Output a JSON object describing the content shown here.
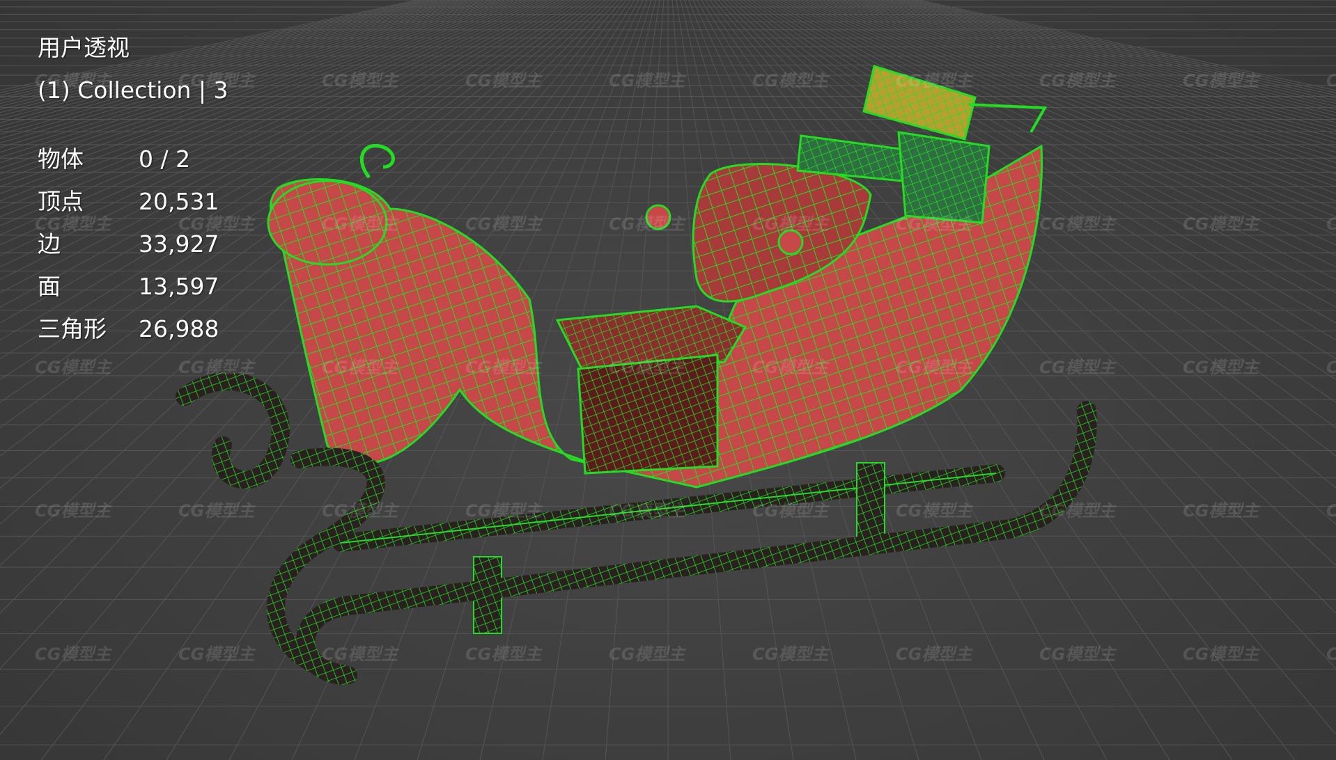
{
  "viewport": {
    "view_name": "用户透视",
    "collection_info": "(1) Collection | 3",
    "stats": [
      {
        "label": "物体",
        "value": "0 / 2"
      },
      {
        "label": "顶点",
        "value": "20,531"
      },
      {
        "label": "边",
        "value": "33,927"
      },
      {
        "label": "面",
        "value": "13,597"
      },
      {
        "label": "三角形",
        "value": "26,988"
      }
    ]
  },
  "watermark": {
    "logo_text": "CG模型主"
  },
  "colors": {
    "background": "#3d3d3d",
    "grid_line": "#555555",
    "wire": "#22dd22",
    "sleigh_body": "#c74848",
    "sleigh_dark": "#5c1c1c",
    "runner": "#2a2020",
    "gift_gold": "#b8a030",
    "gift_green": "#2e6e40"
  }
}
